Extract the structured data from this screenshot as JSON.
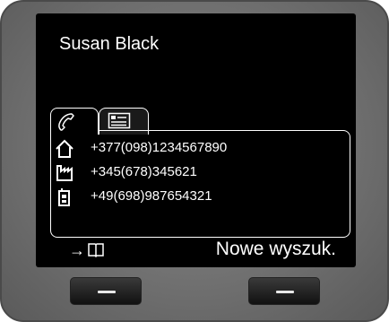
{
  "contact": {
    "name": "Susan Black"
  },
  "tabs": [
    {
      "icon": "phone-handset-icon",
      "active": true
    },
    {
      "icon": "contact-card-icon",
      "active": false
    }
  ],
  "numbers": [
    {
      "type_icon": "home-icon",
      "number": "+377(098)1234567890"
    },
    {
      "type_icon": "office-icon",
      "number": "+345(678)345621"
    },
    {
      "type_icon": "mobile-icon",
      "number": "+49(698)987654321"
    }
  ],
  "softkeys": {
    "left_arrow": "→",
    "left_icon": "book-icon",
    "right_label": "Nowe wyszuk."
  },
  "colors": {
    "screen_bg": "#000000",
    "text": "#ffffff",
    "bezel": "#6e6e6e"
  }
}
